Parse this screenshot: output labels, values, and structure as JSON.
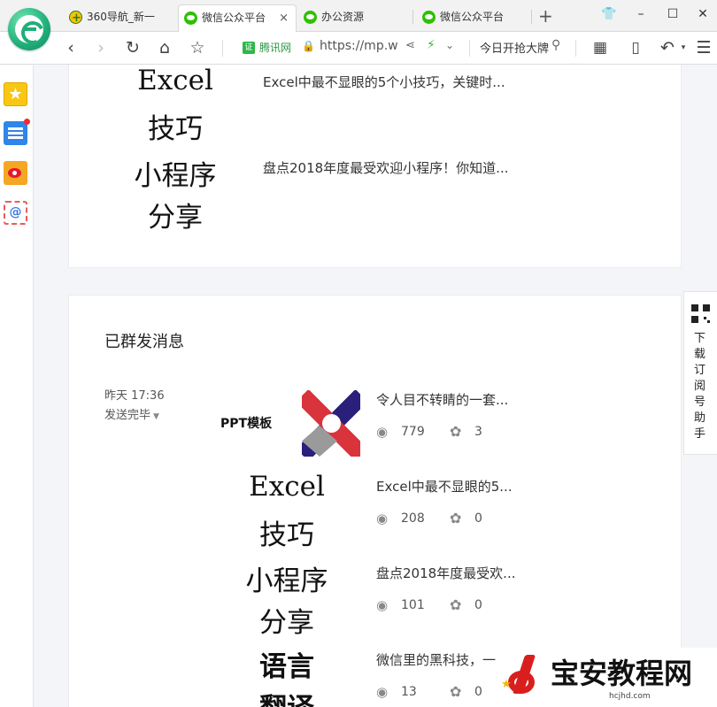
{
  "browser": {
    "tabs": [
      {
        "title": "360导航_新一",
        "favicon": "nav360-icon",
        "active": false
      },
      {
        "title": "微信公众平台",
        "favicon": "wechat-icon",
        "active": true
      },
      {
        "title": "办公资源",
        "favicon": "wechat-icon",
        "active": false
      },
      {
        "title": "微信公众平台",
        "favicon": "wechat-icon",
        "active": false
      }
    ],
    "close_glyph": "×",
    "new_tab_glyph": "+",
    "address": {
      "cert_label": "腾讯网",
      "url": "https://mp.w",
      "search_text": "今日开抢大牌"
    }
  },
  "icons": {
    "back": "‹",
    "forward": "›",
    "refresh": "↻",
    "home": "⌂",
    "star": "☆",
    "apps": "▦",
    "phone": "▯",
    "undo": "↶",
    "menu": "☰",
    "lock": "🔒",
    "share": "⋖",
    "bolt": "⚡",
    "chevron": "⌄",
    "search": "⚲",
    "eye": "◉",
    "gear": "✿",
    "caret": "▼"
  },
  "top_card": {
    "thumb_lines": [
      "Excel",
      "技巧",
      "小程序",
      "分享"
    ],
    "articles": [
      {
        "title": "Excel中最不显眼的5个小技巧，关键时..."
      },
      {
        "title": "盘点2018年度最受欢迎小程序！你知道..."
      }
    ]
  },
  "sent": {
    "section_title": "已群发消息",
    "time": "昨天 17:36",
    "status": "发送完毕",
    "ppt_label": "PPT模板",
    "thumb_lines": [
      "Excel",
      "技巧",
      "小程序",
      "分享",
      "语言",
      "翻译"
    ],
    "articles": [
      {
        "title": "令人目不转睛的一套...",
        "views": "779",
        "likes": "3"
      },
      {
        "title": "Excel中最不显眼的5...",
        "views": "208",
        "likes": "0"
      },
      {
        "title": "盘点2018年度最受欢...",
        "views": "101",
        "likes": "0"
      },
      {
        "title": "微信里的黑科技，一",
        "views": "13",
        "likes": "0"
      }
    ]
  },
  "float": {
    "qr_text": "下载订阅号助手"
  },
  "watermark": {
    "title": "宝安教程网",
    "url": "hcjhd.com"
  },
  "colors": {
    "wechat_green": "#2dc100",
    "accent_red": "#d91e1e"
  }
}
